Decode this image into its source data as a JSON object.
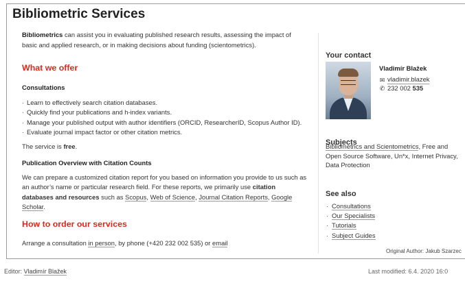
{
  "page": {
    "title": "Bibliometric Services"
  },
  "intro": {
    "bold_term": "Bibliometrics",
    "text": " can assist you in evaluating published research results, assessing the impact of basic and applied research, or in making decisions about funding (scientometrics)."
  },
  "offer": {
    "heading": "What we offer",
    "consultations_heading": "Consultations",
    "items": [
      "Learn to effectively search citation databases.",
      "Quickly find your publications and h-index variants.",
      "Manage your published output with author identifiers (ORCID, ResearcherID, Scopus Author ID).",
      "Evaluate journal impact factor or other citation metrics."
    ],
    "service_free_prefix": "The service is ",
    "service_free_bold": "free",
    "service_free_suffix": "."
  },
  "overview": {
    "heading": "Publication Overview with Citation Counts",
    "text_start": "We can prepare a customized citation report for you based on information you provide to us such as an author’s name or particular research field. For these reports, we primarily use ",
    "bold_text": "citation databases and resources",
    "such_as": " such as ",
    "links": [
      "Scopus",
      "Web of Science",
      "Journal Citation Reports",
      "Google Scholar"
    ],
    "sep": ", ",
    "end": "."
  },
  "order": {
    "heading": "How to order our services",
    "text_start": "Arrange a consultation ",
    "in_person_link": "in person",
    "text_middle": ", by phone (+420 232 002 535) or ",
    "email_link": "email"
  },
  "contact": {
    "heading": "Your contact",
    "name": "Vladimír Blažek",
    "email": "vladimir.blazek",
    "phone_prefix": "232 002 ",
    "phone_bold": "535"
  },
  "subjects": {
    "heading": "Subjects",
    "link_text": "Bibliometrics and Scientometrics",
    "rest": ", Free and Open Source Software, Un*x, Internet Privacy, Data Protection"
  },
  "see_also": {
    "heading": "See also",
    "items": [
      "Consultations",
      "Our Specialists",
      "Tutorials",
      "Subject Guides"
    ]
  },
  "original_author": "Original Author: Jakub Szarzec",
  "footer": {
    "editor_label": "Editor: ",
    "editor_name": "Vladimír Blažek",
    "last_modified": "Last modified: 6.4. 2020 16:0"
  },
  "colors": {
    "accent_red": "#d52b1e",
    "text": "#333333",
    "border": "#9a9a9a"
  },
  "icons": [
    "email-icon",
    "phone-icon"
  ]
}
